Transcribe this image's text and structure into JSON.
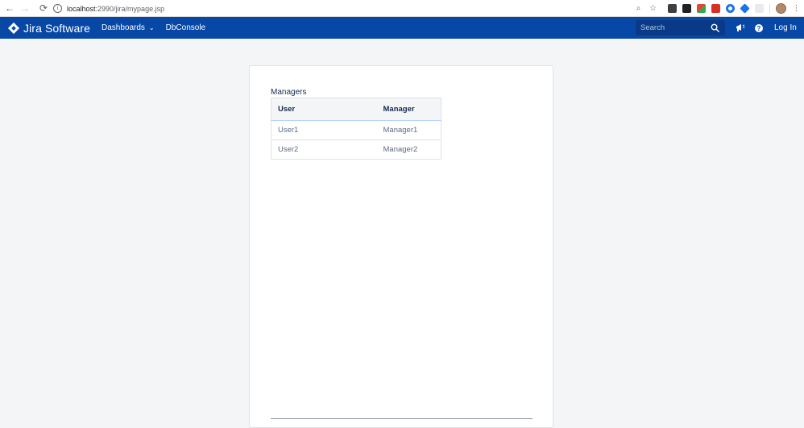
{
  "browser": {
    "back_icon": "←",
    "forward_icon": "→",
    "reload_icon": "⟳",
    "info_icon": "i",
    "url_host": "localhost",
    "url_path": ":2990/jira/mypage.jsp",
    "zoom_icon": "⌕",
    "star_icon": "☆",
    "menu_icon": "⋮"
  },
  "header": {
    "logo_text": "Jira Software",
    "menu": [
      {
        "label": "Dashboards",
        "chevron": "⌄"
      },
      {
        "label": "DbConsole"
      }
    ],
    "search_placeholder": "Search",
    "notifications_icon": "📢",
    "help_icon": "?",
    "login_label": "Log In"
  },
  "content": {
    "section_title": "Managers",
    "table": {
      "headers": [
        "User",
        "Manager"
      ],
      "rows": [
        [
          "User1",
          "Manager1"
        ],
        [
          "User2",
          "Manager2"
        ]
      ]
    }
  },
  "colors": {
    "header_bg": "#0747a6",
    "page_bg": "#f4f5f7"
  }
}
